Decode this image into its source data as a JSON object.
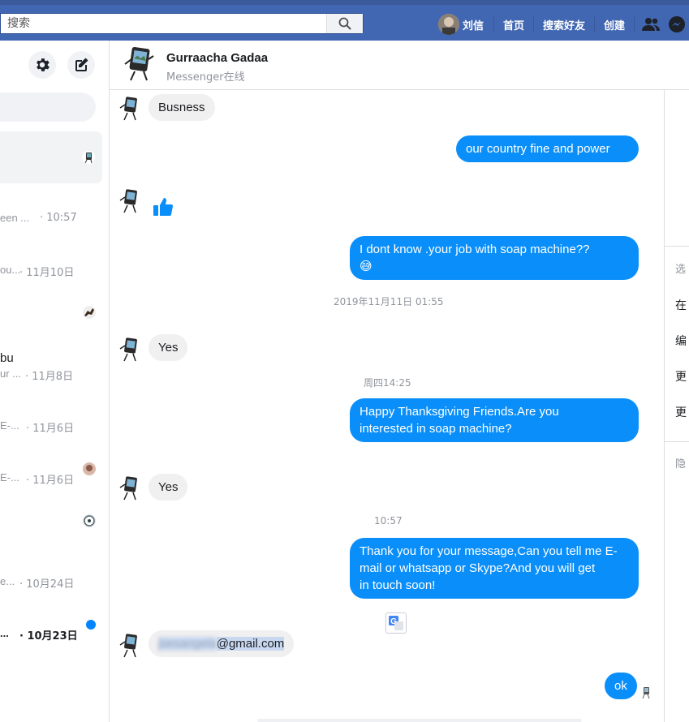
{
  "topbar": {
    "search_placeholder": "搜索",
    "user_name": "刘信",
    "nav": [
      "首页",
      "搜索好友",
      "创建"
    ]
  },
  "sidebar": {
    "conversations": [
      {
        "name": "",
        "snippet": "een ...",
        "time": "· 10:57"
      },
      {
        "name": "",
        "snippet": "ou...",
        "time": "· 11月10日"
      },
      {
        "name": "bu",
        "snippet": "ur ...",
        "time": "· 11月8日"
      },
      {
        "name": "",
        "snippet": "E-...",
        "time": "· 11月6日"
      },
      {
        "name": "",
        "snippet": "E-...",
        "time": "· 11月6日"
      },
      {
        "name": "",
        "snippet": "e...",
        "time": "· 10月24日"
      },
      {
        "name": "",
        "snippet": "...",
        "time": "· 10月23日"
      }
    ]
  },
  "chat": {
    "contact_name": "Gurraacha Gadaa",
    "contact_status": "Messenger在线",
    "messages": {
      "m1": "Busness",
      "m2": "our  country fine and  power",
      "m3_line1": "I  dont  know  .your  job  with soap  machine??",
      "m3_emoji": "😅",
      "ts1": "2019年11月11日 01:55",
      "m4": "Yes",
      "ts2": "周四14:25",
      "m5_line1": "Happy  Thanksgiving  Friends.Are  you",
      "m5_line2": "interested  in  soap machine?",
      "m6": "Yes",
      "ts3": "10:57",
      "m7_line1": "Thank you for your message,Can you tell me E-",
      "m7_line2": "mail  or  whatsapp or Skype?And you will get",
      "m7_line3": "in touch soon!",
      "m8_blurred": "jsesangela",
      "m8_domain": "@gmail.com",
      "m9": "ok"
    }
  },
  "rightpane": {
    "items": [
      "选",
      "在",
      "编",
      "更",
      "更",
      "隐"
    ]
  },
  "colors": {
    "topbar": "#4267b2",
    "outgoing": "#0a8ffa",
    "incoming": "#f1f0f0"
  }
}
